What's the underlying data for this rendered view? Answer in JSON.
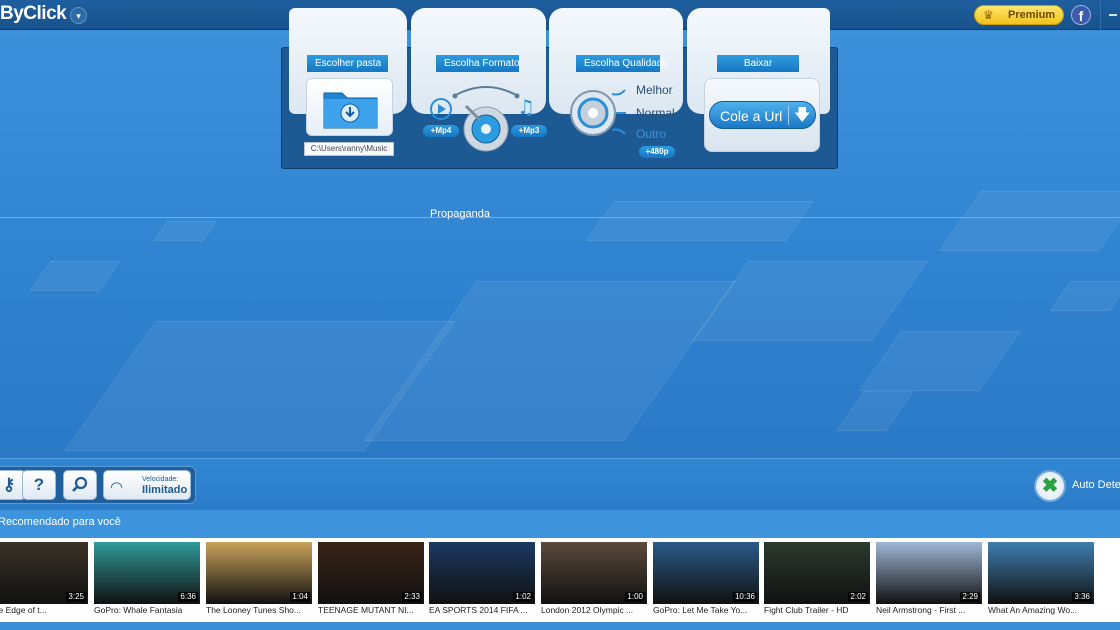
{
  "app": {
    "title": "ByClick",
    "menu_glyph": "▾"
  },
  "header": {
    "premium_label": "Premium",
    "premium_icon": "crown-icon",
    "facebook_label": "f",
    "minimize_label": ""
  },
  "download_panel": {
    "folder": {
      "label": "Escolher pasta",
      "icon": "folder-download-icon",
      "path": "C:\\Users\\ranny\\Music"
    },
    "format": {
      "label": "Escolha Formato",
      "video_option": "+Mp4",
      "audio_option": "+Mp3"
    },
    "quality": {
      "label": "Escolha Qualidade",
      "options": [
        "Melhor",
        "Normal",
        "Outro"
      ],
      "selected": "Outro",
      "resolution": "+480p"
    },
    "download": {
      "label": "Baixar",
      "button_label": "Cole a Url",
      "button_icon": "download-arrow-icon"
    }
  },
  "ad": {
    "label": "Propaganda"
  },
  "toolbar": {
    "help_label": "?",
    "speed_caption": "Velocidade:",
    "speed_value": "Ilimitado",
    "auto_detect_label": "Auto Detec",
    "auto_detect_glyph": "✖"
  },
  "recommended": {
    "title": "Recomendado para você",
    "videos": [
      {
        "title": "at the Edge of t...",
        "duration": "3:25",
        "color": "#3a3228"
      },
      {
        "title": "GoPro: Whale Fantasia",
        "duration": "6:36",
        "color": "#2f9a9a"
      },
      {
        "title": "The Looney Tunes Sho...",
        "duration": "1:04",
        "color": "#c9a25a"
      },
      {
        "title": "TEENAGE MUTANT NI...",
        "duration": "2:33",
        "color": "#3b2418"
      },
      {
        "title": "EA SPORTS 2014 FIFA ...",
        "duration": "1:02",
        "color": "#1b3a63"
      },
      {
        "title": "London 2012 Olympic ...",
        "duration": "1:00",
        "color": "#5a4a3a"
      },
      {
        "title": "GoPro: Let Me Take Yo...",
        "duration": "10:36",
        "color": "#2a5a88"
      },
      {
        "title": "Fight Club Trailer - HD",
        "duration": "2:02",
        "color": "#2c3a30"
      },
      {
        "title": "Neil Armstrong - First ...",
        "duration": "2:29",
        "color": "#9fb7d6"
      },
      {
        "title": "What An Amazing Wo...",
        "duration": "3:36",
        "color": "#3f7fb0"
      }
    ]
  }
}
